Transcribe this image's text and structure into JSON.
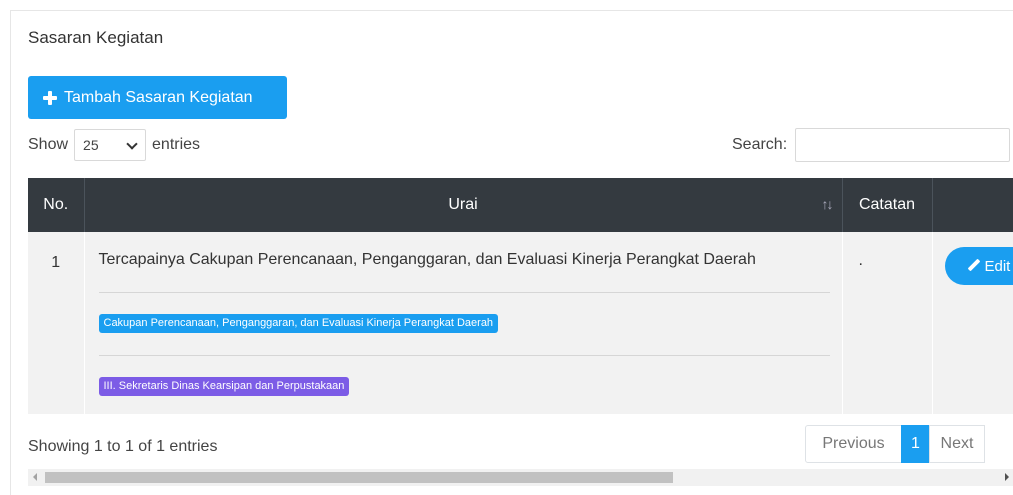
{
  "card": {
    "title": "Sasaran Kegiatan",
    "add_button_label": "Tambah Sasaran Kegiatan"
  },
  "length": {
    "show_label": "Show",
    "selected_value": "25",
    "entries_label": "entries"
  },
  "search": {
    "label": "Search:",
    "value": "",
    "placeholder": ""
  },
  "table": {
    "headers": [
      "No.",
      "Urai",
      "Catatan",
      ""
    ],
    "rows": [
      {
        "no": "1",
        "urai_title": "Tercapainya Cakupan Perencanaan, Penganggaran, dan Evaluasi Kinerja Perangkat Daerah",
        "badge_indicator": "Cakupan Perencanaan, Penganggaran, dan Evaluasi Kinerja Perangkat Daerah",
        "badge_unit": "III. Sekretaris Dinas Kearsipan dan Perpustakaan",
        "catatan": ".",
        "edit_label": "Edit"
      }
    ]
  },
  "info": "Showing 1 to 1 of 1 entries",
  "pagination": {
    "previous": "Previous",
    "current": "1",
    "next": "Next"
  },
  "scrollbar": {
    "visible_fraction": 0.66
  },
  "colors": {
    "primary": "#1a9ef0",
    "header_bg": "#343a40",
    "badge_purple": "#7c5ce6",
    "row_bg": "#f2f2f2"
  },
  "icons": {
    "add": "plus-icon",
    "select": "chevron-down-icon",
    "sort": "sort-icon",
    "edit": "pencil-icon"
  }
}
